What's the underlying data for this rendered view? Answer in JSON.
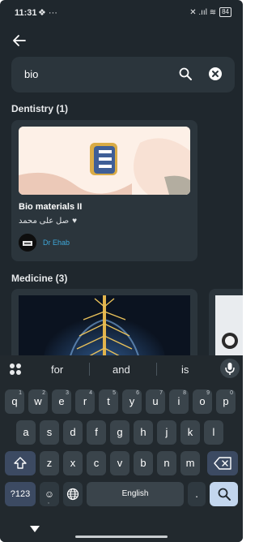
{
  "status": {
    "time": "11:31",
    "time_icons": "❖ ···",
    "right_icons": "✕ .ııl ≋",
    "battery": "84"
  },
  "search": {
    "query": "bio"
  },
  "sections": {
    "dentistry": "Dentistry (1)",
    "medicine": "Medicine (3)"
  },
  "card": {
    "title": "Bio materials II",
    "subtitle": "صل على محمد",
    "heart": "♥",
    "author": "Dr Ehab"
  },
  "keyboard": {
    "suggestions": [
      "for",
      "and",
      "is"
    ],
    "row1": [
      {
        "k": "q",
        "s": "1"
      },
      {
        "k": "w",
        "s": "2"
      },
      {
        "k": "e",
        "s": "3"
      },
      {
        "k": "r",
        "s": "4"
      },
      {
        "k": "t",
        "s": "5"
      },
      {
        "k": "y",
        "s": "6"
      },
      {
        "k": "u",
        "s": "7"
      },
      {
        "k": "i",
        "s": "8"
      },
      {
        "k": "o",
        "s": "9"
      },
      {
        "k": "p",
        "s": "0"
      }
    ],
    "row2": [
      "a",
      "s",
      "d",
      "f",
      "g",
      "h",
      "j",
      "k",
      "l"
    ],
    "row3": [
      "z",
      "x",
      "c",
      "v",
      "b",
      "n",
      "m"
    ],
    "numbers": "?123",
    "emoji": "☺",
    "comma": ",",
    "space": "English",
    "period": "."
  },
  "colors": {
    "background": "#1f272d",
    "card": "#2b353c",
    "accent_link": "#3ea7d9",
    "search_key": "#c3d6ee"
  },
  "icons": {
    "back": "arrow-left-icon",
    "search": "search-icon",
    "clear": "clear-circle-icon",
    "grid": "apps-grid-icon",
    "mic": "microphone-icon",
    "shift": "shift-icon",
    "backspace": "backspace-icon",
    "globe": "globe-icon"
  }
}
